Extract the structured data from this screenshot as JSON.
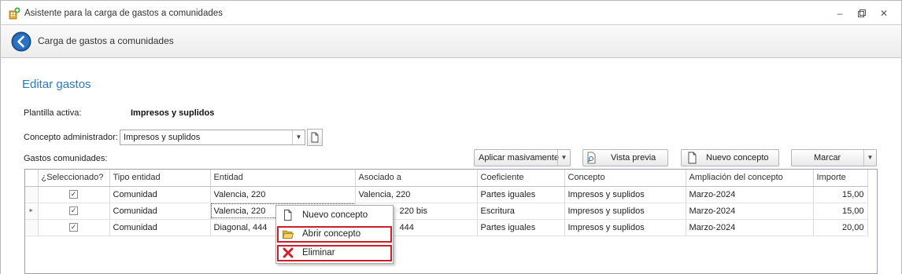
{
  "window": {
    "title": "Asistente para la carga de gastos a comunidades",
    "minimize_icon": "minimize-icon",
    "maximize_icon": "restore-icon",
    "close_icon": "close-icon"
  },
  "navbar": {
    "back_icon": "back-arrow-icon",
    "title": "Carga de gastos a comunidades"
  },
  "section": {
    "title": "Editar gastos"
  },
  "form": {
    "plantilla_label": "Plantilla activa:",
    "plantilla_value": "Impresos y suplidos",
    "concepto_label": "Concepto administrador:",
    "concepto_value": "Impresos y suplidos",
    "gastos_label": "Gastos comunidades:"
  },
  "toolbar": {
    "aplicar": "Aplicar masivamente",
    "vista_previa": "Vista previa",
    "nuevo_concepto": "Nuevo concepto",
    "marcar": "Marcar"
  },
  "grid": {
    "columns": [
      "¿Seleccionado?",
      "Tipo entidad",
      "Entidad",
      "Asociado a",
      "Coeficiente",
      "Concepto",
      "Ampliación del concepto",
      "Importe"
    ],
    "rows": [
      {
        "selected": true,
        "tipo": "Comunidad",
        "entidad": "Valencia, 220",
        "asociado": "Valencia, 220",
        "coeficiente": "Partes iguales",
        "concepto": "Impresos y suplidos",
        "ampliacion": "Marzo-2024",
        "importe": "15,00"
      },
      {
        "selected": true,
        "tipo": "Comunidad",
        "entidad": "Valencia, 220",
        "asociado": "220 bis",
        "coeficiente": "Escritura",
        "concepto": "Impresos y suplidos",
        "ampliacion": "Marzo-2024",
        "importe": "15,00"
      },
      {
        "selected": true,
        "tipo": "Comunidad",
        "entidad": "Diagonal, 444",
        "asociado": "444",
        "coeficiente": "Partes iguales",
        "concepto": "Impresos y suplidos",
        "ampliacion": "Marzo-2024",
        "importe": "20,00"
      }
    ]
  },
  "context_menu": {
    "items": [
      {
        "label": "Nuevo concepto",
        "icon": "new-document-icon"
      },
      {
        "label": "Abrir concepto",
        "icon": "open-folder-icon"
      },
      {
        "label": "Eliminar",
        "icon": "delete-x-icon"
      }
    ]
  },
  "colors": {
    "accent": "#2b7bc0",
    "highlight_border": "#cc1f2a"
  }
}
